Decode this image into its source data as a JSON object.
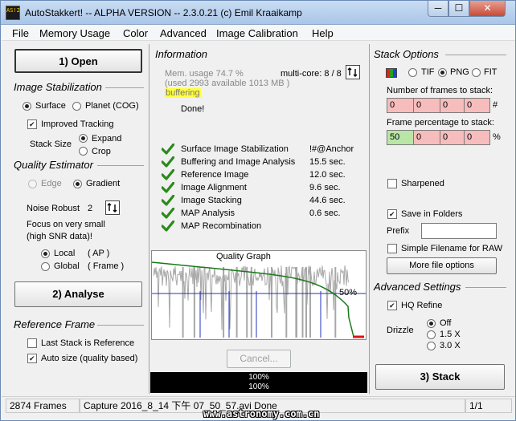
{
  "window": {
    "title": "AutoStakkert! -- ALPHA VERSION -- 2.3.0.21  (c) Emil Kraaikamp",
    "icon_text": "AS!2",
    "minimize": "─",
    "maximize": "☐",
    "close": "✕"
  },
  "menu": [
    "File",
    "Memory Usage",
    "Color",
    "Advanced",
    "Image Calibration",
    "Help"
  ],
  "left": {
    "open_label": "1) Open",
    "stabilization": {
      "title": "Image Stabilization",
      "surface": "Surface",
      "planet": "Planet (COG)",
      "improved_tracking": "Improved Tracking",
      "stack_size": "Stack Size",
      "expand": "Expand",
      "crop": "Crop"
    },
    "quality": {
      "title": "Quality Estimator",
      "edge": "Edge",
      "gradient": "Gradient",
      "noise_robust": "Noise Robust",
      "noise_value": "2",
      "focus_line1": "Focus on very small",
      "focus_line2": "(high SNR data)!",
      "local": "Local",
      "local_tag": "( AP )",
      "global": "Global",
      "global_tag": "( Frame )"
    },
    "analyse_label": "2) Analyse",
    "reference": {
      "title": "Reference Frame",
      "last_stack": "Last Stack is Reference",
      "auto_size": "Auto size (quality based)"
    }
  },
  "info": {
    "title": "Information",
    "mem_line1": "Mem. usage 74.7 %",
    "mem_line2": "(used 2993 available 1013 MB )",
    "buffering": "buffering",
    "multicore": "multi-core: 8 / 8",
    "done": "Done!",
    "steps": [
      {
        "name": "Surface Image Stabilization",
        "value": "!#@Anchor"
      },
      {
        "name": "Buffering and Image Analysis",
        "value": "15.5 sec."
      },
      {
        "name": "Reference Image",
        "value": "12.0 sec."
      },
      {
        "name": "Image Alignment",
        "value": "9.6 sec."
      },
      {
        "name": "Image Stacking",
        "value": "44.6 sec."
      },
      {
        "name": "MAP Analysis",
        "value": "0.6 sec."
      },
      {
        "name": "MAP Recombination",
        "value": ""
      }
    ],
    "graph_title": "Quality Graph",
    "graph_pct": "50%",
    "cancel": "Cancel...",
    "progress1": "100%",
    "progress2": "100%"
  },
  "stack": {
    "title": "Stack Options",
    "tif": "TIF",
    "png": "PNG",
    "fit": "FIT",
    "frames_label": "Number of frames to stack:",
    "frames_values": [
      "0",
      "0",
      "0",
      "0"
    ],
    "frames_unit": "#",
    "pct_label": "Frame percentage to stack:",
    "pct_values": [
      "50",
      "0",
      "0",
      "0"
    ],
    "pct_unit": "%",
    "sharpened": "Sharpened",
    "save_folders": "Save in Folders",
    "prefix": "Prefix",
    "simple_filename": "Simple Filename for RAW",
    "more_options": "More file options",
    "advanced_title": "Advanced Settings",
    "hq_refine": "HQ Refine",
    "drizzle": "Drizzle",
    "drizzle_off": "Off",
    "drizzle_15": "1.5 X",
    "drizzle_30": "3.0 X",
    "stack_label": "3) Stack"
  },
  "status": {
    "frames": "2874 Frames",
    "file": "Capture 2016_8_14 下午 07_50_57.avi   Done",
    "page": "1/1"
  },
  "watermark": "www.astronomy.com.cn",
  "colors": {
    "graph_gray": "#a8a8a8",
    "graph_green": "#1a7a1a",
    "graph_blue": "#2030c0",
    "graph_red": "#e01010"
  }
}
